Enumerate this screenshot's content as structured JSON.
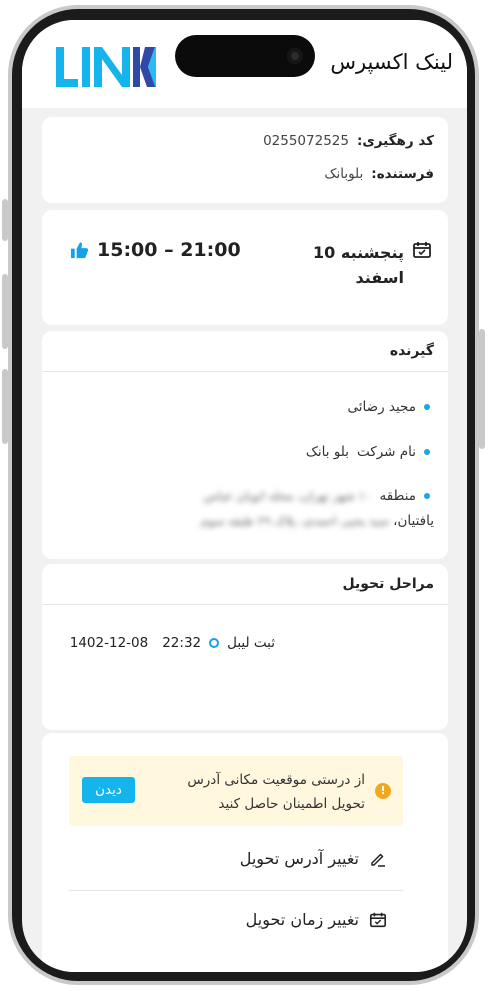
{
  "app": {
    "title": "لینک اکسپرس",
    "logo_text": "LINK"
  },
  "shipment": {
    "tracking_label": "کد رهگیری:",
    "tracking_code": "0255072525",
    "sender_label": "فرستنده:",
    "sender_name": "بلوبانک"
  },
  "schedule": {
    "day": "پنجشنبه 10",
    "month": "اسفند",
    "time_range": "15:00 – 21:00"
  },
  "receiver": {
    "title": "گیرنده",
    "name": "مجید رضائی",
    "company_label": "نام شرکت",
    "company": "بلو بانک",
    "address_label": "منطقه",
    "address_line1": "۱۰ شهر تهران، محله اتوبان عباس",
    "address_line2": "یافتیان،",
    "address_line3": "سید یحیی احمدی، پلاک ۲۹ طبقه سوم"
  },
  "steps": {
    "title": "مراحل تحویل",
    "items": [
      {
        "label": "ثبت لیبل",
        "time": "22:32",
        "date": "1402-12-08"
      }
    ]
  },
  "notice": {
    "line1": "از درستی موقعیت مکانی آدرس",
    "line2": "تحویل اطمینان حاصل کنید",
    "button_label": "دیدن"
  },
  "actions": {
    "change_address": "تغییر آدرس تحویل",
    "change_time": "تغییر زمان تحویل"
  },
  "colors": {
    "brand_blue": "#15b4ec",
    "logo_dark": "#2f49a7",
    "bullet": "#1aa6e8",
    "warning": "#f2a81d",
    "notice_bg": "#fff8df"
  }
}
